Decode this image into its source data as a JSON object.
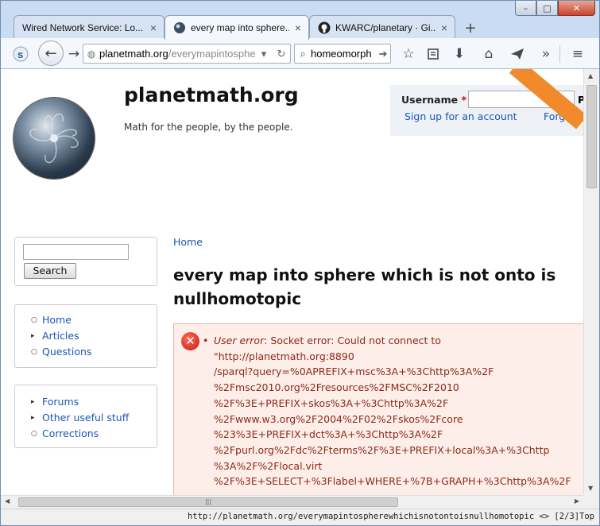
{
  "tabs": [
    {
      "title": "Wired Network Service: Lo...",
      "active": false
    },
    {
      "title": "every map into sphere...",
      "active": true
    },
    {
      "title": "KWARC/planetary · Gi...",
      "active": false
    }
  ],
  "window_controls": {
    "minimize": "–",
    "maximize": "□",
    "close": "✕"
  },
  "nav": {
    "url_host": "planetmath.org",
    "url_path": "/everymapintosphere",
    "search_value": "homeomorph"
  },
  "site": {
    "name": "planetmath.org",
    "slogan": "Math for the people, by the people."
  },
  "login": {
    "username_label": "Username",
    "required_mark": "*",
    "password_initial": "P",
    "signup_link": "Sign up for an account",
    "forgot_link": "Forgot p"
  },
  "sidebar": {
    "search_button": "Search",
    "menu1": [
      {
        "label": "Home",
        "bullet": "○"
      },
      {
        "label": "Articles",
        "bullet": "▸"
      },
      {
        "label": "Questions",
        "bullet": "○"
      }
    ],
    "menu2": [
      {
        "label": "Forums",
        "bullet": "▸"
      },
      {
        "label": "Other useful stuff",
        "bullet": "▸"
      },
      {
        "label": "Corrections",
        "bullet": "○"
      }
    ]
  },
  "main": {
    "breadcrumb": "Home",
    "title": "every map into sphere which is not onto is nullhomotopic",
    "error": {
      "label": "User error",
      "first_line": ": Socket error: Could not connect to",
      "lines": [
        "\"http://planetmath.org:8890",
        "/sparql?query=%0APREFIX+msc%3A+%3Chttp%3A%2F",
        "%2Fmsc2010.org%2Fresources%2FMSC%2F2010",
        "%2F%3E+PREFIX+skos%3A+%3Chttp%3A%2F",
        "%2Fwww.w3.org%2F2004%2F02%2Fskos%2Fcore",
        "%23%3E+PREFIX+dct%3A+%3Chttp%3A%2F",
        "%2Fpurl.org%2Fdc%2Fterms%2F%3E+PREFIX+local%3A+%3Chttp",
        "%3A%2F%2Flocal.virt",
        "%2F%3E+SELECT+%3Flabel+WHERE+%7B+GRAPH+%3Chttp%3A%2F"
      ]
    }
  },
  "statusbar": {
    "text": "http://planetmath.org/everymapintospherewhichisnotontoisnullhomotopic <> [2/3]Top"
  }
}
